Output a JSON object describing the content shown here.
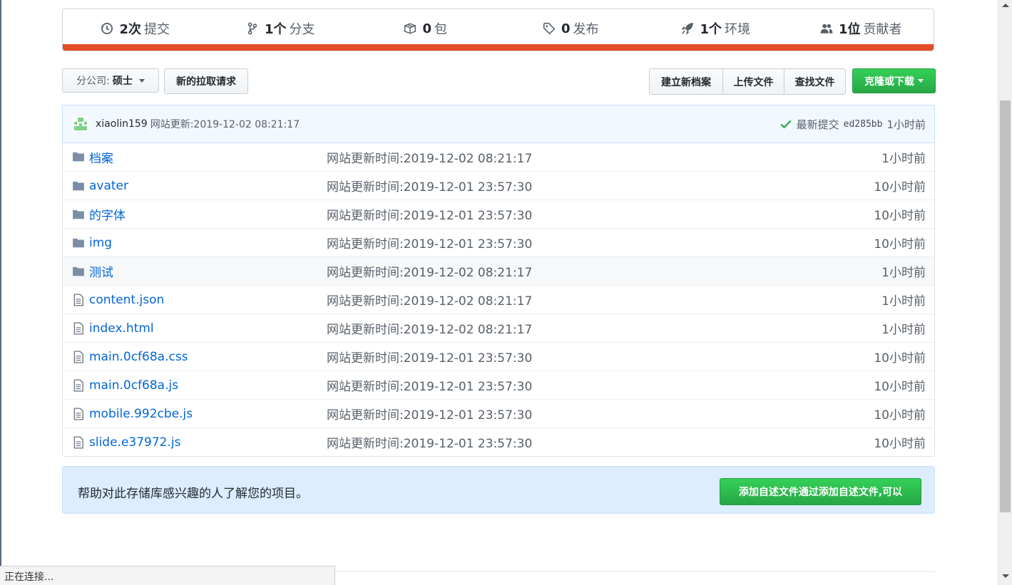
{
  "summary": {
    "commits": {
      "num": "2次",
      "label": "提交"
    },
    "branches": {
      "num": "1个",
      "label": "分支"
    },
    "packages": {
      "num": "0",
      "label": "包"
    },
    "releases": {
      "num": "0",
      "label": "发布"
    },
    "environments": {
      "num": "1个",
      "label": "环境"
    },
    "contributors": {
      "num": "1位",
      "label": "贡献者"
    },
    "language_color": "#e34c26"
  },
  "toolbar": {
    "branch_prefix": "分公司:",
    "branch_name": "硕士",
    "new_pr": "新的拉取请求",
    "create_file": "建立新档案",
    "upload_files": "上传文件",
    "find_file": "查找文件",
    "clone": "克隆或下载"
  },
  "commit": {
    "author": "xiaolin159",
    "message": "网站更新:2019-12-02 08:21:17",
    "latest_label": "最新提交",
    "sha": "ed285bb",
    "age": "1小时前"
  },
  "files": [
    {
      "type": "dir",
      "name": "档案",
      "msg": "网站更新时间:2019-12-02 08:21:17",
      "age": "1小时前"
    },
    {
      "type": "dir",
      "name": "avater",
      "msg": "网站更新时间:2019-12-01 23:57:30",
      "age": "10小时前"
    },
    {
      "type": "dir",
      "name": "的字体",
      "msg": "网站更新时间:2019-12-01 23:57:30",
      "age": "10小时前"
    },
    {
      "type": "dir",
      "name": "img",
      "msg": "网站更新时间:2019-12-01 23:57:30",
      "age": "10小时前"
    },
    {
      "type": "dir",
      "name": "测试",
      "msg": "网站更新时间:2019-12-02 08:21:17",
      "age": "1小时前"
    },
    {
      "type": "file",
      "name": "content.json",
      "msg": "网站更新时间:2019-12-02 08:21:17",
      "age": "1小时前"
    },
    {
      "type": "file",
      "name": "index.html",
      "msg": "网站更新时间:2019-12-02 08:21:17",
      "age": "1小时前"
    },
    {
      "type": "file",
      "name": "main.0cf68a.css",
      "msg": "网站更新时间:2019-12-01 23:57:30",
      "age": "10小时前"
    },
    {
      "type": "file",
      "name": "main.0cf68a.js",
      "msg": "网站更新时间:2019-12-01 23:57:30",
      "age": "10小时前"
    },
    {
      "type": "file",
      "name": "mobile.992cbe.js",
      "msg": "网站更新时间:2019-12-01 23:57:30",
      "age": "10小时前"
    },
    {
      "type": "file",
      "name": "slide.e37972.js",
      "msg": "网站更新时间:2019-12-01 23:57:30",
      "age": "10小时前"
    }
  ],
  "readme_prompt": {
    "text": "帮助对此存储库感兴趣的人了解您的项目。",
    "button": "添加自述文件通过添加自述文件,可以"
  },
  "status_bar": "正在连接..."
}
